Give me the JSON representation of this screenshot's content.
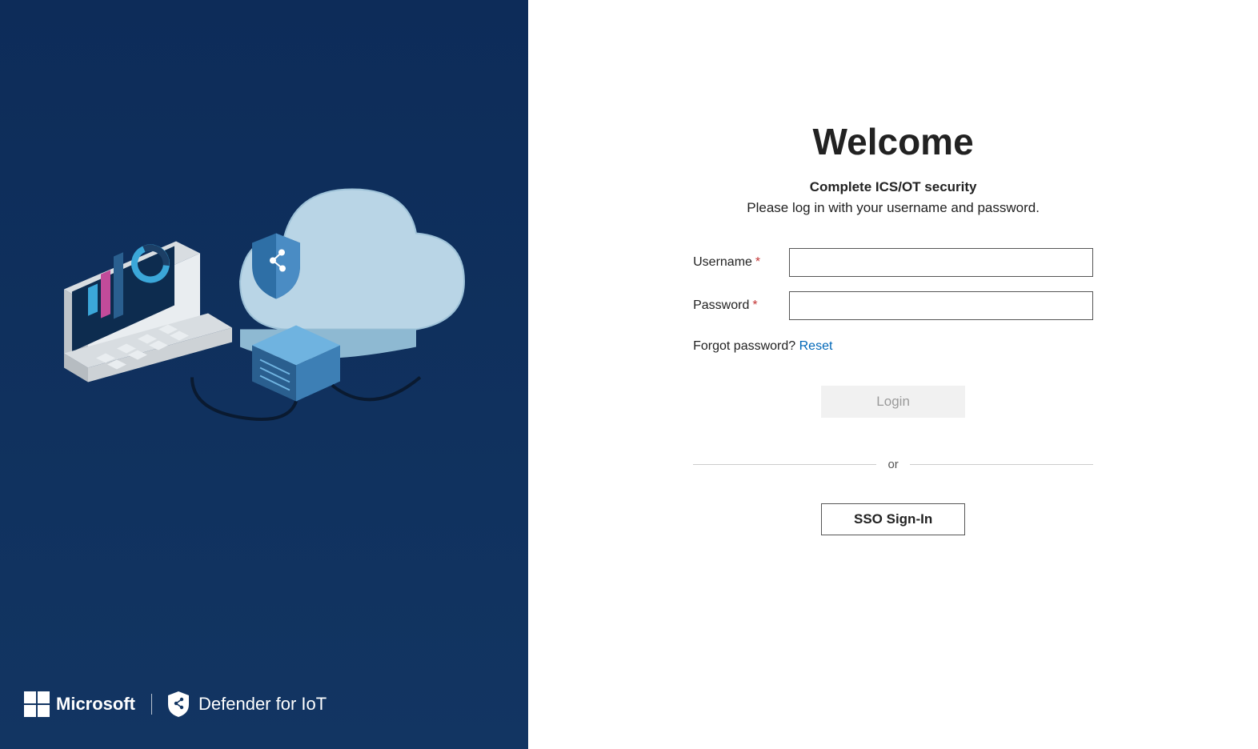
{
  "branding": {
    "microsoft": "Microsoft",
    "product": "Defender for IoT"
  },
  "login": {
    "title": "Welcome",
    "subtitle": "Complete ICS/OT security",
    "instruction": "Please log in with your username and password.",
    "username_label": "Username",
    "password_label": "Password",
    "forgot_text": "Forgot password? ",
    "reset_link": "Reset",
    "login_button": "Login",
    "divider_text": "or",
    "sso_button": "SSO Sign-In"
  }
}
